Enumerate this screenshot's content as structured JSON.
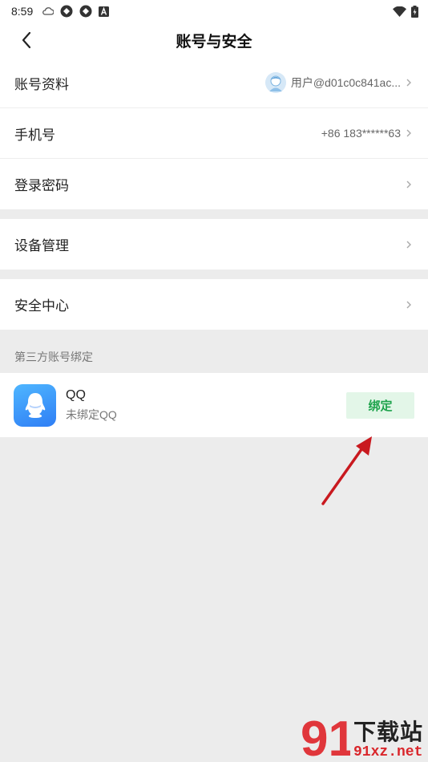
{
  "status_bar": {
    "time": "8:59",
    "left_icons": [
      "cloud-icon",
      "app-icon",
      "app-icon",
      "a-icon"
    ],
    "right_icons": [
      "wifi-icon",
      "battery-icon"
    ]
  },
  "header": {
    "title": "账号与安全",
    "back_icon": "chevron-left-icon"
  },
  "account": {
    "rows": [
      {
        "label": "账号资料",
        "value": "用户@d01c0c841ac..."
      },
      {
        "label": "手机号",
        "value": "+86 183******63"
      },
      {
        "label": "登录密码",
        "value": ""
      }
    ]
  },
  "device": {
    "label": "设备管理"
  },
  "security": {
    "label": "安全中心"
  },
  "third_party": {
    "section_title": "第三方账号绑定",
    "items": [
      {
        "name": "QQ",
        "status": "未绑定QQ",
        "action": "绑定"
      }
    ]
  },
  "colors": {
    "background": "#ececec",
    "bind_button_bg": "#e3f6e8",
    "bind_button_text": "#1ea34c",
    "annotation_arrow": "#d9262b"
  },
  "watermark": {
    "number": "91",
    "name": "下载站",
    "url": "91xz.net"
  }
}
